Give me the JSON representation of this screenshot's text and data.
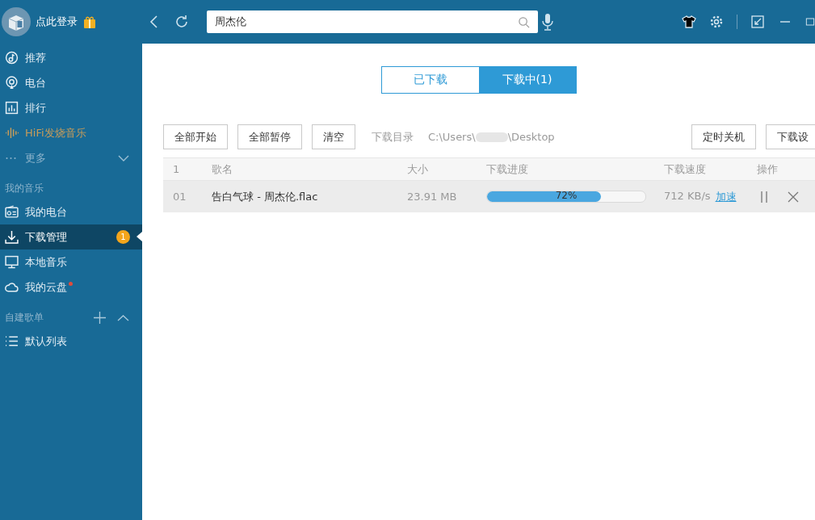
{
  "header": {
    "login_label": "点此登录",
    "search": {
      "value": "周杰伦"
    }
  },
  "sidebar": {
    "nav": [
      {
        "label": "推荐",
        "kind": "normal",
        "selected": false
      },
      {
        "label": "电台",
        "kind": "normal",
        "selected": false
      },
      {
        "label": "排行",
        "kind": "normal",
        "selected": false
      },
      {
        "label": "HiFi发烧音乐",
        "kind": "hifi",
        "selected": false
      },
      {
        "label": "更多",
        "kind": "more",
        "selected": false
      }
    ],
    "my_music": {
      "title": "我的音乐",
      "items": [
        {
          "label": "我的电台",
          "selected": false
        },
        {
          "label": "下载管理",
          "selected": true,
          "badge": "1"
        },
        {
          "label": "本地音乐",
          "selected": false
        },
        {
          "label": "我的云盘",
          "selected": false,
          "dot": true
        }
      ]
    },
    "playlists": {
      "title": "自建歌单",
      "expanded": true,
      "items": [
        {
          "label": "默认列表",
          "selected": false
        }
      ]
    }
  },
  "tabs": [
    {
      "label": "已下载",
      "selected": false
    },
    {
      "label": "下载中(1)",
      "selected": true
    }
  ],
  "toolbar": {
    "left_buttons": [
      "全部开始",
      "全部暂停",
      "清空"
    ],
    "dir_label": "下载目录",
    "path_start": "C:\\Users\\",
    "path_end": "\\Desktop",
    "right_buttons": [
      "定时关机",
      "下载设"
    ]
  },
  "table": {
    "columns": [
      "1",
      "歌名",
      "大小",
      "下载进度",
      "下载速度",
      "操作"
    ],
    "rows": [
      {
        "index": "01",
        "name": "告白气球 - 周杰伦.flac",
        "size": "23.91 MB",
        "level": 0.72,
        "progress": "72%",
        "speed": "712 KB/s",
        "boost": "加速"
      }
    ]
  }
}
